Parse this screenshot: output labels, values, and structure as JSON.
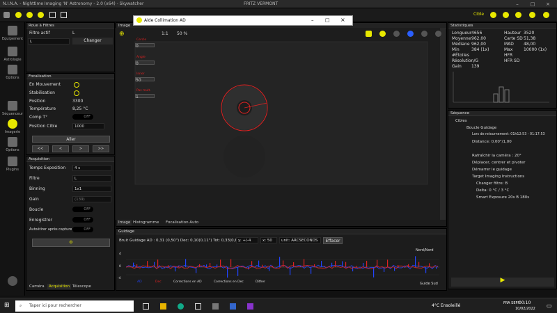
{
  "app": {
    "title": "N.I.N.A. - Nighttime Imaging 'N' Astronomy - 2.0 (x64) - Skywatcher",
    "center": "FRITZ VERMONT",
    "profile": "Cible"
  },
  "toolbar": {},
  "sidebar": [
    {
      "label": "Equipement"
    },
    {
      "label": "Astrologie"
    },
    {
      "label": "Options"
    },
    {
      "label": "Séquenceur"
    },
    {
      "label": "Imagerie"
    },
    {
      "label": "Options"
    },
    {
      "label": "Plugins"
    }
  ],
  "filters": {
    "title": "Roue à Filtres",
    "active_label": "Filtre actif",
    "active_value": "L",
    "select": "L",
    "change": "Changer"
  },
  "focuser": {
    "title": "Focalisation",
    "moving": "En Mouvement",
    "stabilize": "Stabilisation",
    "position": "Position",
    "position_val": "3300",
    "temp": "Température",
    "temp_val": "8,25 °C",
    "comp": "Comp T°",
    "comp_val": "OFF",
    "target": "Position Cible",
    "target_val": "1000",
    "go": "Aller",
    "step_buttons": [
      "<<",
      "<",
      ">",
      ">>"
    ]
  },
  "acq": {
    "title": "Acquisition",
    "exposure": "Temps Exposition",
    "exposure_val": "4 s",
    "filter": "Filtre",
    "filter_val": "L",
    "binning": "Binning",
    "binning_val": "1x1",
    "gain": "Gain",
    "gain_val": "(139)",
    "loop": "Boucle",
    "loop_val": "OFF",
    "save": "Enregistrer",
    "save_val": "OFF",
    "autostretch": "Autoétirer après capture",
    "autostretch_val": "OFF",
    "tabs": [
      "Caméra",
      "Acquisition",
      "Télescope"
    ]
  },
  "image": {
    "title": "Image",
    "zoom": "1:1",
    "percent": "50 %",
    "tabs": [
      "Image",
      "Histogramme",
      "Focalisation Auto"
    ],
    "overlay_labels": [
      "Cercle",
      "Angle",
      "Inner",
      "Pas mult."
    ],
    "overlay_values": [
      "0",
      "0",
      "50",
      "1"
    ]
  },
  "dialog": {
    "title": "Aide Collimation AD",
    "close": "×",
    "maximize": "□",
    "minimize": "–"
  },
  "stats": {
    "title": "Statistiques",
    "l1": "Longueur",
    "v1": "4656",
    "l2": "Moyenne",
    "v2": "962,00",
    "l3": "Médiane",
    "v3": "962,00",
    "l4": "Min",
    "v4": "384 (1x)",
    "l5": "#Étoiles",
    "v5": "",
    "l6": "Résolution/G",
    "v6": "",
    "l7": "Gain",
    "v7": "139",
    "r1": "Hauteur",
    "rv1": "3520",
    "r2": "Carte SD",
    "rv2": "51,38",
    "r3": "MAD",
    "rv3": "48,00",
    "r4": "Max",
    "rv4": "10000 (1x)",
    "r5": "HFR",
    "rv5": "",
    "r6": "HFR SD",
    "rv6": ""
  },
  "sequence": {
    "title": "Séquence",
    "items": [
      "Cibles",
      "Boucle Guidage",
      "Lors de retournement: 01h12:53 - 01:17:53",
      "Distance: 0,00°/1,00",
      "Rafraîchir la caméra : 20°",
      "Déplacer, centrer et pivoter",
      "Démarrer le guidage",
      "Target Imaging Instructions",
      "Changer filtre: B",
      "Delta: 0 °C / 3 °C",
      "Smart Exposure 20s B 180s"
    ]
  },
  "guiding": {
    "title": "Guidage",
    "rms": "Bruit Guidage AD : 0,31 (0,50\") Dec: 0,10(0,11\") Tot: 0,33(0,67\")",
    "y_axis": "y: +/-4",
    "x_axis": "x: 50",
    "unit": "unit: ARCSECONDS",
    "clear": "Effacer",
    "north": "Nord/Nord",
    "south": "Guide Sud",
    "legend": [
      "AD",
      "Dec",
      "Corrections en AD",
      "Corrections en Dec",
      "Dither"
    ],
    "yticks": [
      "4",
      "2",
      "0",
      "-2",
      "-4"
    ]
  },
  "taskbar": {
    "search": "Taper ici pour rechercher",
    "weather": "4°C Ensoleillé",
    "time": "00:10",
    "date": "10/02/2022",
    "lang": "FRA SEFR"
  },
  "colors": {
    "accent": "#e8e800",
    "red": "#dd2222",
    "blue": "#2244ff"
  }
}
